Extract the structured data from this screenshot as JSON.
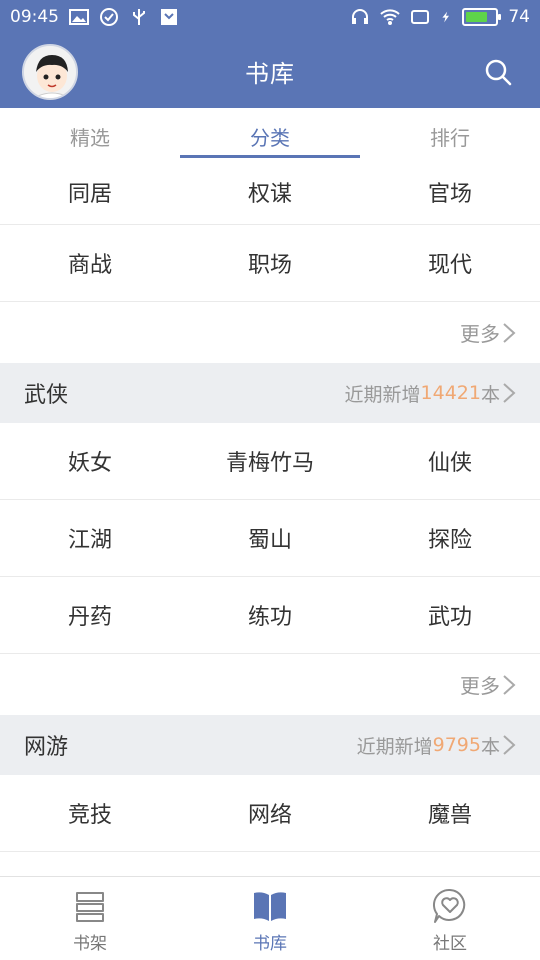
{
  "status_bar": {
    "time": "09:45",
    "battery": "74"
  },
  "header": {
    "title": "书库"
  },
  "tabs": [
    {
      "label": "精选"
    },
    {
      "label": "分类"
    },
    {
      "label": "排行"
    }
  ],
  "sections": [
    {
      "rows": [
        [
          "同居",
          "权谋",
          "官场"
        ],
        [
          "商战",
          "职场",
          "现代"
        ]
      ],
      "more": "更多"
    },
    {
      "name": "武侠",
      "meta_prefix": "近期新增",
      "meta_count": "14421",
      "meta_suffix": "本",
      "rows": [
        [
          "妖女",
          "青梅竹马",
          "仙侠"
        ],
        [
          "江湖",
          "蜀山",
          "探险"
        ],
        [
          "丹药",
          "练功",
          "武功"
        ]
      ],
      "more": "更多"
    },
    {
      "name": "网游",
      "meta_prefix": "近期新增",
      "meta_count": "9795",
      "meta_suffix": "本",
      "rows": [
        [
          "竞技",
          "网络",
          "魔兽"
        ]
      ]
    }
  ],
  "bottom_nav": [
    {
      "label": "书架",
      "icon": "bookshelf-icon"
    },
    {
      "label": "书库",
      "icon": "book-icon"
    },
    {
      "label": "社区",
      "icon": "community-icon"
    }
  ],
  "colors": {
    "primary": "#5a75b5",
    "accent_number": "#f0a874",
    "section_bg": "#eceef1"
  }
}
